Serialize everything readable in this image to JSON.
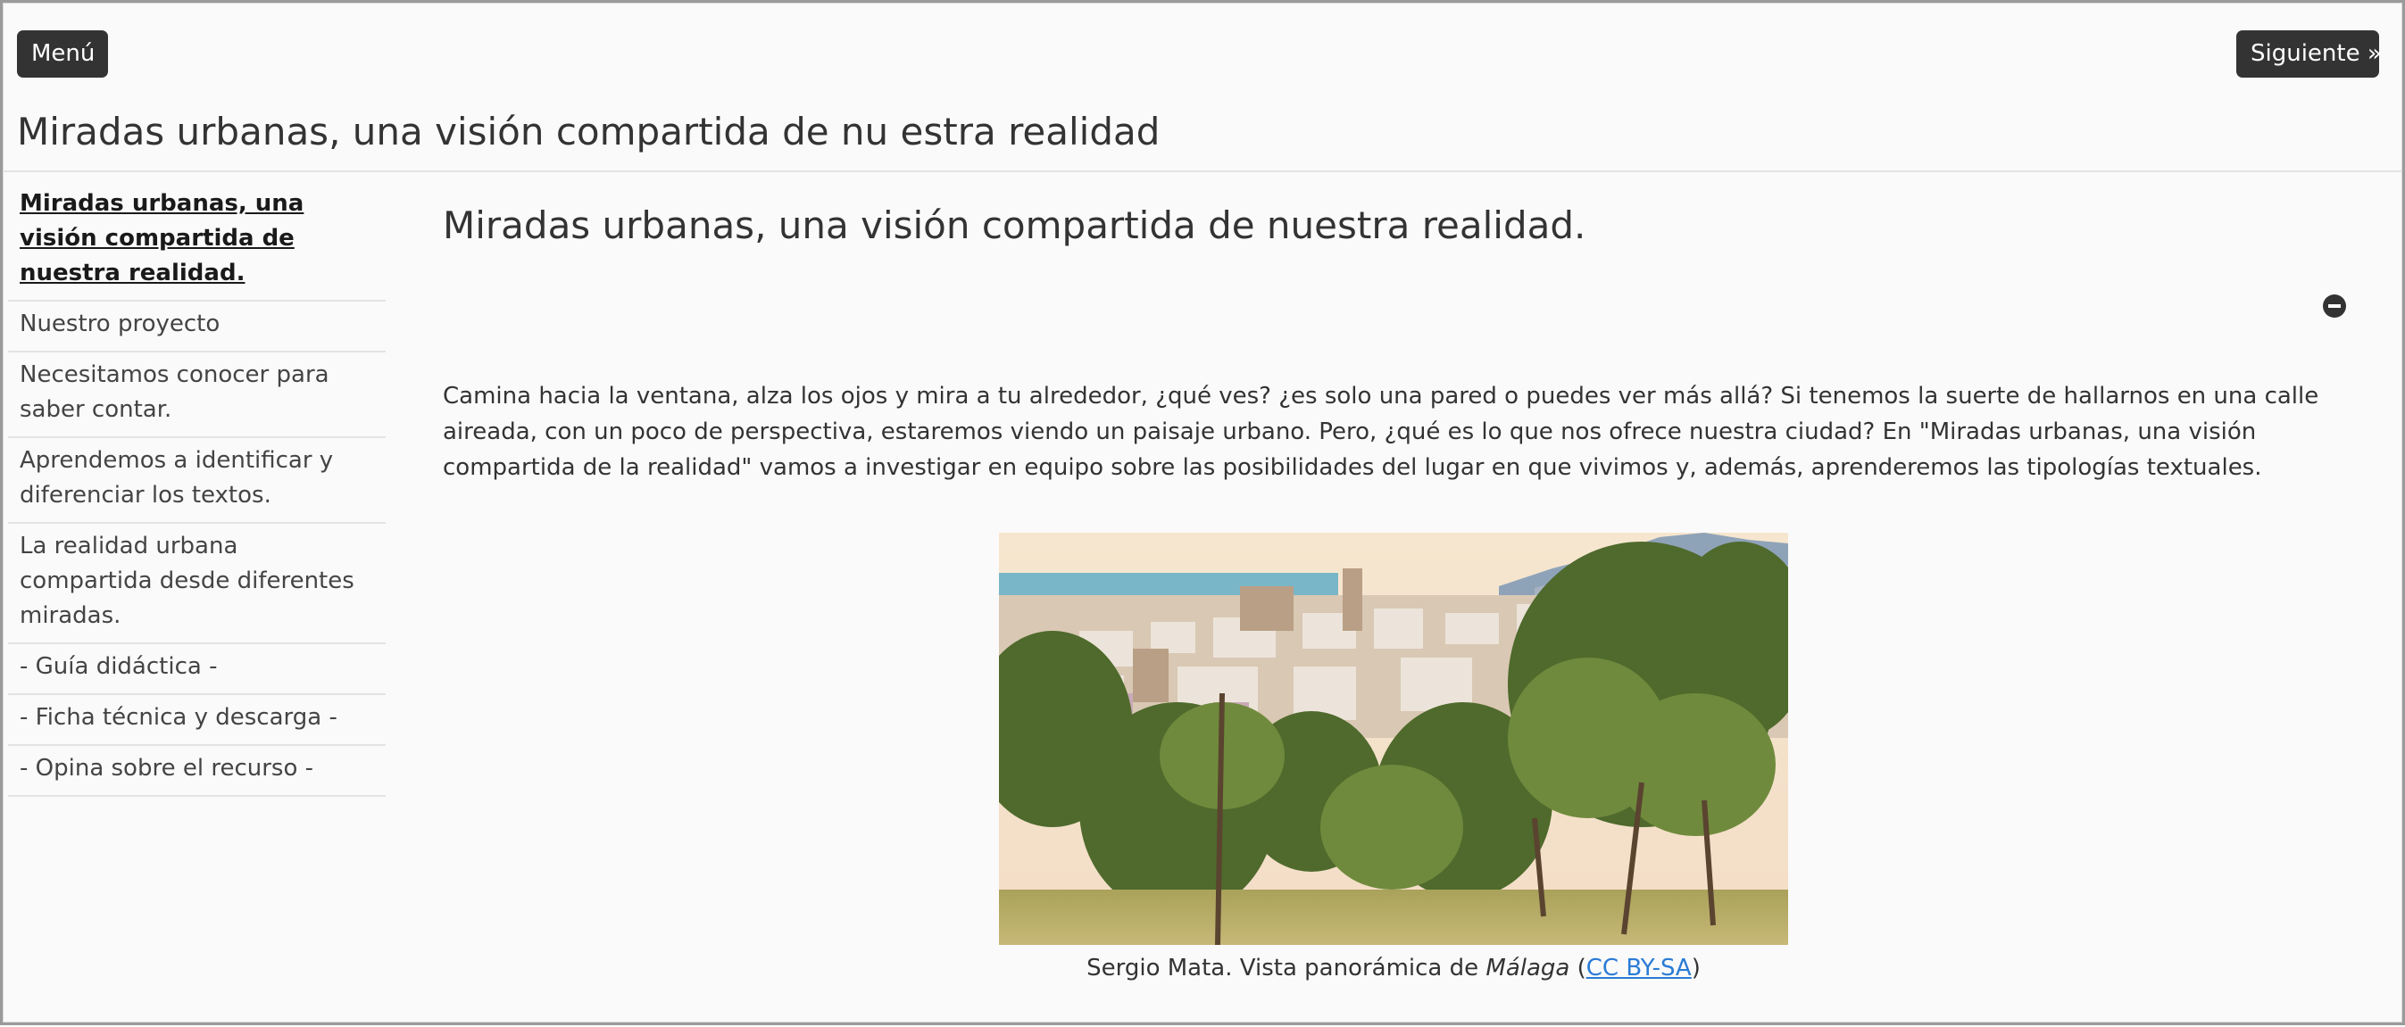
{
  "toolbar": {
    "menu_label": "Menú",
    "next_label": "Siguiente »"
  },
  "header": {
    "title": "Miradas urbanas, una visión compartida de nu estra realidad"
  },
  "sidebar": {
    "items": [
      {
        "label": "Miradas urbanas, una visión compartida de nuestra realidad.",
        "current": true
      },
      {
        "label": "Nuestro proyecto"
      },
      {
        "label": "Necesitamos conocer para saber contar."
      },
      {
        "label": "Aprendemos a identificar y diferenciar los textos."
      },
      {
        "label": "La realidad urbana compartida desde diferentes miradas."
      },
      {
        "label": "- Guía didáctica -"
      },
      {
        "label": "- Ficha técnica y descarga -"
      },
      {
        "label": "- Opina sobre el recurso -"
      }
    ]
  },
  "main": {
    "title": "Miradas urbanas, una visión compartida de nuestra realidad.",
    "toggle_icon": "minus-circle-icon",
    "intro": "Camina hacia la ventana, alza los ojos y mira a tu alrededor, ¿qué ves? ¿es solo una pared o puedes ver más allá? Si tenemos la suerte de hallarnos en una calle aireada, con un poco de perspectiva, estaremos viendo un paisaje urbano. Pero, ¿qué es lo que nos ofrece nuestra ciudad? En \"Miradas urbanas, una visión compartida de la realidad\" vamos a investigar en equipo sobre las posibilidades del lugar en que vivimos y, además, aprenderemos las tipologías textuales.",
    "figure": {
      "caption_prefix": "Sergio Mata. Vista panorámica de ",
      "caption_place": "Málaga",
      "caption_open": " (",
      "caption_license": "CC BY-SA",
      "caption_close": ")"
    }
  },
  "colors": {
    "button_bg": "#333333",
    "link": "#2a7bd6",
    "page_bg": "#fafafa"
  }
}
